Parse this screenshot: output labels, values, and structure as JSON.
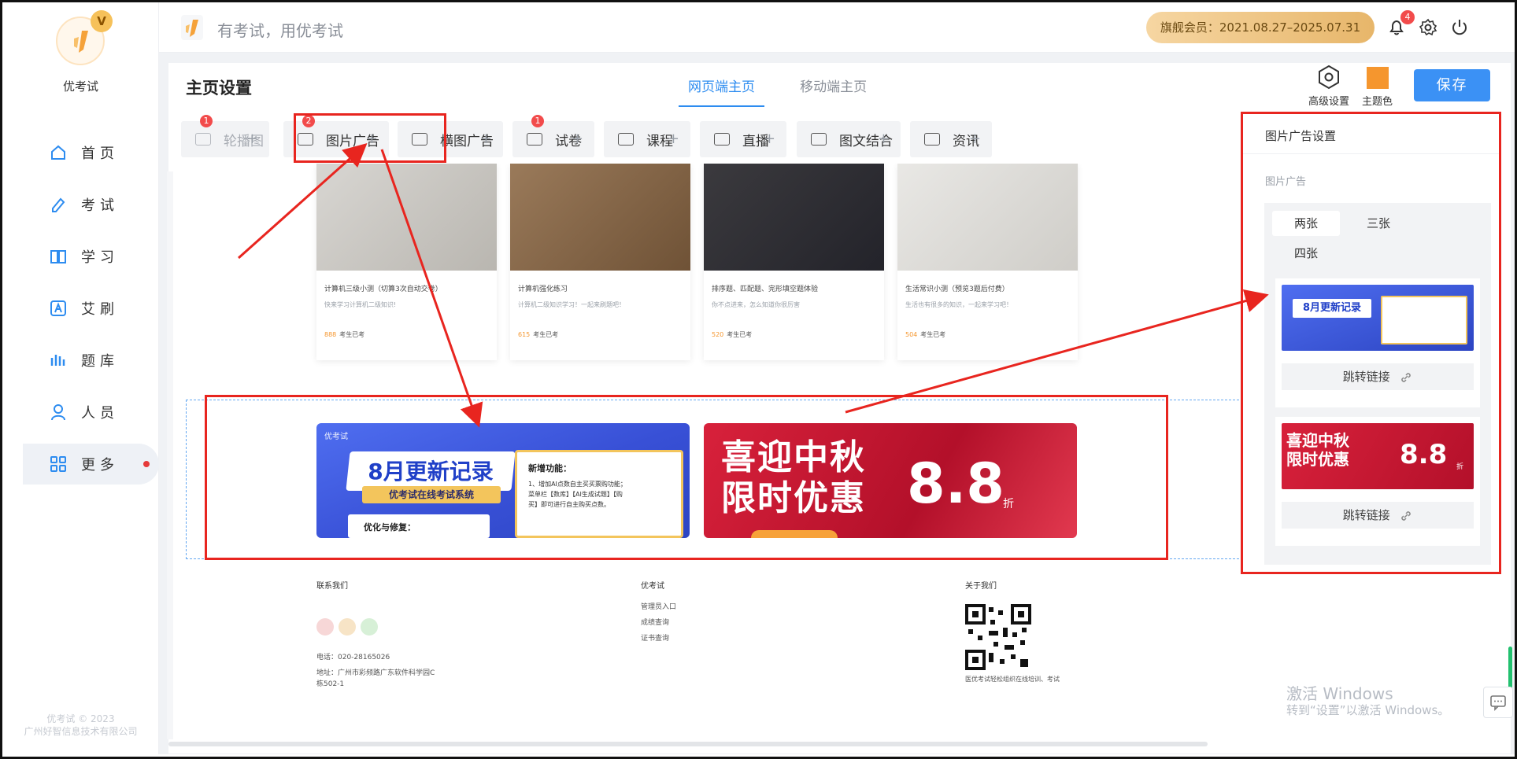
{
  "brand": {
    "name": "优考试",
    "vip": "V",
    "copyright_1": "优考试 © 2023",
    "copyright_2": "广州好智信息技术有限公司"
  },
  "nav": [
    {
      "label": "首页",
      "icon": "home-icon"
    },
    {
      "label": "考试",
      "icon": "pencil-icon"
    },
    {
      "label": "学习",
      "icon": "book-icon"
    },
    {
      "label": "艾刷",
      "icon": "a-icon"
    },
    {
      "label": "题库",
      "icon": "bars-icon"
    },
    {
      "label": "人员",
      "icon": "user-icon"
    },
    {
      "label": "更多",
      "icon": "grid-icon",
      "active": true
    }
  ],
  "header": {
    "slogan": "有考试，用优考试",
    "member": "旗舰会员：2021.08.27–2025.07.31",
    "notifications": "4"
  },
  "page": {
    "title": "主页设置",
    "tabs": [
      "网页端主页",
      "移动端主页"
    ],
    "tools": {
      "advanced": "高级设置",
      "theme": "主题色",
      "theme_color": "#f5962e"
    },
    "save": "保存"
  },
  "components": [
    {
      "label": "轮播图",
      "badge": "1",
      "disabled": true
    },
    {
      "label": "图片广告",
      "badge": "2"
    },
    {
      "label": "横图广告"
    },
    {
      "label": "试卷",
      "badge": "1"
    },
    {
      "label": "课程"
    },
    {
      "label": "直播"
    },
    {
      "label": "图文结合"
    },
    {
      "label": "资讯"
    }
  ],
  "plus": "+",
  "cards": [
    {
      "title": "计算机三级小测（切算3次自动交卷）",
      "desc": "快来学习计算机二级知识!",
      "count": "888",
      "suffix": "考生已考"
    },
    {
      "title": "计算机强化练习",
      "desc": "计算机二级知识学习！一起来刷题吧！",
      "count": "615",
      "suffix": "考生已考"
    },
    {
      "title": "排序题、匹配题、完形填空题体验",
      "desc": "你不点进来，怎么知道你很厉害",
      "count": "520",
      "suffix": "考生已考"
    },
    {
      "title": "生活常识小测（预览3题后付费）",
      "desc": "生活也有很多的知识，一起来学习吧！",
      "count": "504",
      "suffix": "考生已考"
    }
  ],
  "ads": {
    "blue": {
      "logo": "优考试",
      "title": "8月更新记录",
      "subtitle": "优考试在线考试系统",
      "new_heading": "新增功能：",
      "new_body": "1、增加AI点数自主买买票购功能；菜单栏【数库】【AI生成试题】【购买】即可进行自主购买点数。",
      "fix": "优化与修复："
    },
    "red": {
      "title_1": "喜迎中秋",
      "title_2": "限时优惠",
      "number": "8.8",
      "unit": "折"
    }
  },
  "footer": {
    "contact_title": "联系我们",
    "phone": "电话：020-28165026",
    "address_1": "地址：广州市彩频路广东软件科学园C",
    "address_2": "栋502-1",
    "brand_title": "优考试",
    "links": [
      "管理员入口",
      "成绩查询",
      "证书查询"
    ],
    "about_title": "关于我们",
    "qr_caption": "医优考试轻松组织在线培训、考试"
  },
  "settings": {
    "title": "图片广告设置",
    "label": "图片广告",
    "options": [
      "两张",
      "三张",
      "四张"
    ],
    "jump": "跳转链接",
    "thumb1": "8月更新记录",
    "thumb2_1": "喜迎中秋",
    "thumb2_2": "限时优惠",
    "thumb2_num": "8.8",
    "thumb2_unit": "折"
  },
  "watermark": {
    "line1": "激活 Windows",
    "line2": "转到“设置”以激活 Windows。"
  }
}
